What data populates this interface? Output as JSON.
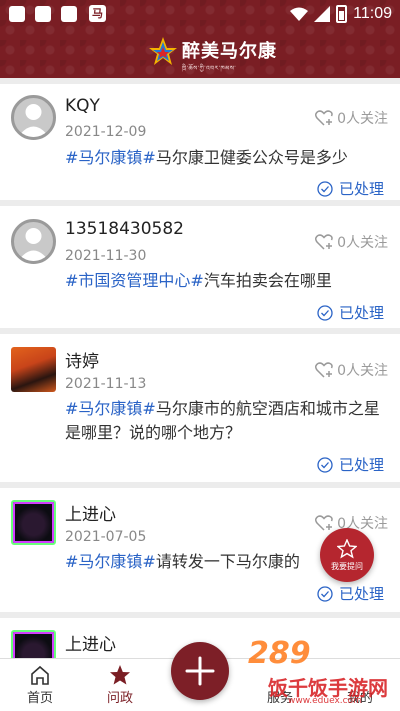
{
  "statusbar": {
    "time": "11:09"
  },
  "header": {
    "title": "醉美马尔康",
    "subtitle": "ཁྲི་ཆོས་ཀྱི་འབར་ཁམས་"
  },
  "posts": [
    {
      "name": "KQY",
      "date": "2021-12-09",
      "follow": "0人关注",
      "tag": "#马尔康镇#",
      "text": "马尔康卫健委公众号是多少",
      "status": "已处理"
    },
    {
      "name": "13518430582",
      "date": "2021-11-30",
      "follow": "0人关注",
      "tag": "#市国资管理中心#",
      "text": "汽车拍卖会在哪里",
      "status": "已处理"
    },
    {
      "name": "诗婷",
      "date": "2021-11-13",
      "follow": "0人关注",
      "tag": "#马尔康镇#",
      "text": "马尔康市的航空酒店和城市之星是哪里？说的哪个地方？",
      "status": "已处理"
    },
    {
      "name": "上进心",
      "date": "2021-07-05",
      "follow": "0人关注",
      "tag": "#马尔康镇#",
      "text": "请转发一下马尔康的",
      "status": "已处理"
    },
    {
      "name": "上进心"
    }
  ],
  "ask_button": {
    "label": "我要提问"
  },
  "tabbar": {
    "home": "首页",
    "politics": "问政",
    "service": "服务",
    "mine": "我的"
  },
  "watermark": {
    "logo": "289",
    "brand": "饭千饭手游网",
    "url": "www.eduex.com"
  },
  "colors": {
    "brand": "#7a1e24",
    "accent": "#2a63c6",
    "ask": "#b5262f"
  }
}
